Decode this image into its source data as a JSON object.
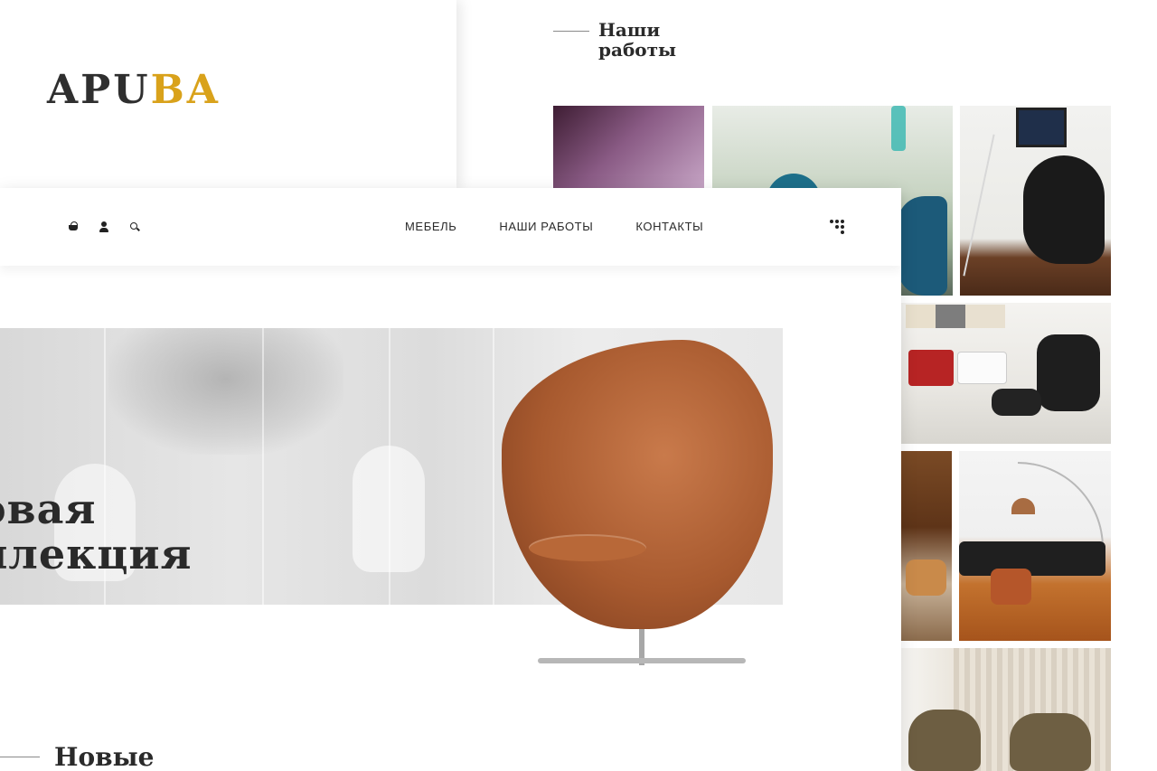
{
  "logo": {
    "part1": "APU",
    "part2": "BA",
    "accent_color": "#d9a21b"
  },
  "works_section": {
    "title_line1": "Наши",
    "title_line2": "работы"
  },
  "nav": {
    "icons": [
      "basket-icon",
      "user-icon",
      "search-icon"
    ],
    "menu": [
      "Мебель",
      "Наши работы",
      "Контакты"
    ],
    "menu_icon": "dots-menu-icon"
  },
  "hero": {
    "title_line1": "овая",
    "title_line2": "ллекция"
  },
  "new_section": {
    "title": "Новые"
  }
}
